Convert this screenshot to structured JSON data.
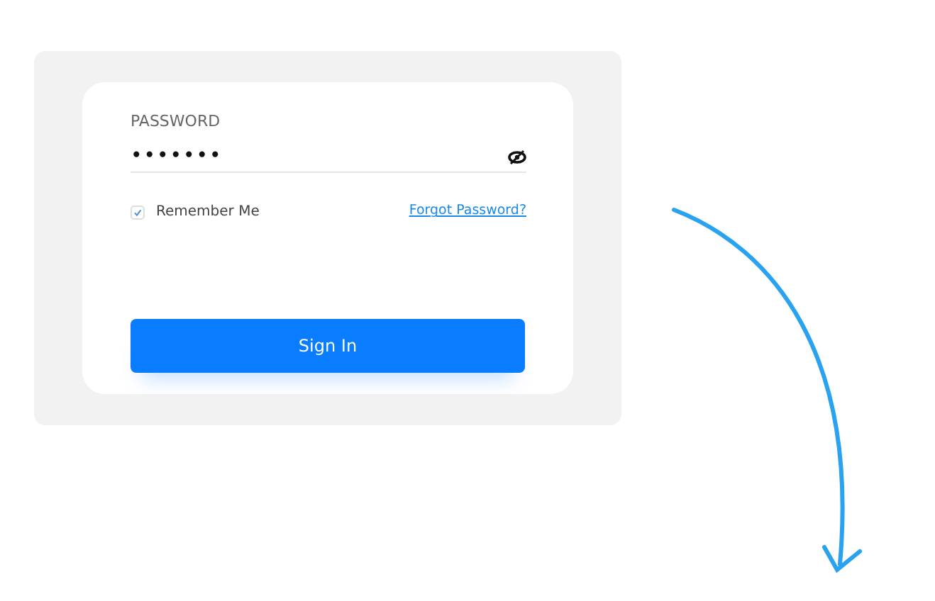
{
  "login_form": {
    "password_label": "PASSWORD",
    "password_value": "•••••••",
    "password_visible": false,
    "remember_me": {
      "label": "Remember Me",
      "checked": true
    },
    "forgot_link": "Forgot Password?",
    "submit_button": "Sign In"
  }
}
